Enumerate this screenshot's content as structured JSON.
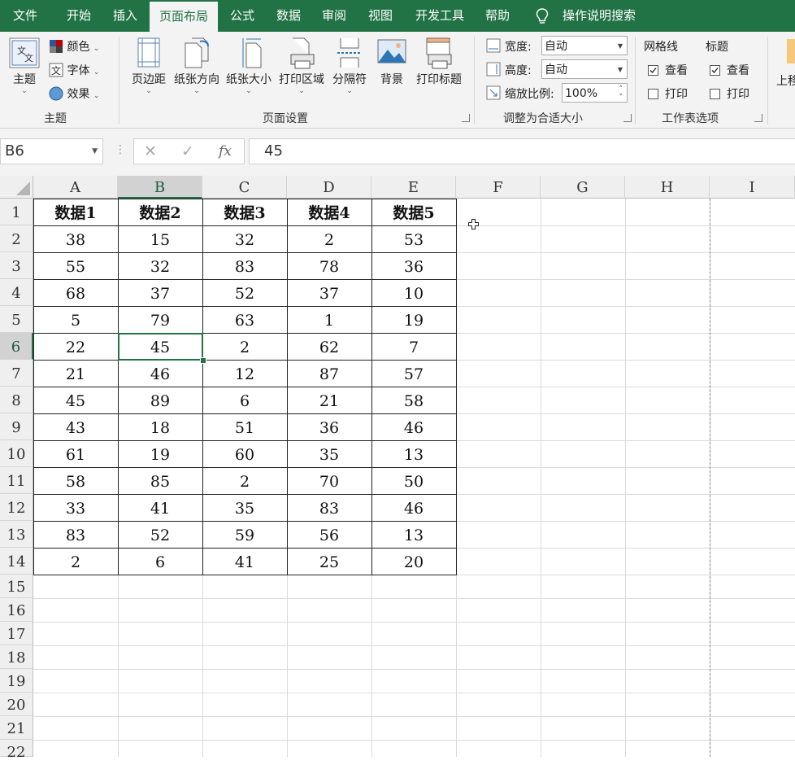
{
  "tabs": [
    "文件",
    "开始",
    "插入",
    "页面布局",
    "公式",
    "数据",
    "审阅",
    "视图",
    "开发工具",
    "帮助"
  ],
  "active_tab": "页面布局",
  "tell_me": "操作说明搜索",
  "ribbon": {
    "theme_group": {
      "themes_label": "主题",
      "colors_label": "颜色",
      "fonts_label": "字体",
      "effects_label": "效果",
      "group_label": "主题"
    },
    "page_setup": {
      "margins": "页边距",
      "orientation": "纸张方向",
      "size": "纸张大小",
      "print_area": "打印区域",
      "breaks": "分隔符",
      "background": "背景",
      "print_titles": "打印标题",
      "group_label": "页面设置"
    },
    "scale_to_fit": {
      "width_label": "宽度:",
      "width_value": "自动",
      "height_label": "高度:",
      "height_value": "自动",
      "scale_label": "缩放比例:",
      "scale_value": "100%",
      "group_label": "调整为合适大小"
    },
    "sheet_options": {
      "gridlines_label": "网格线",
      "headings_label": "标题",
      "view_label": "查看",
      "print_label": "打印",
      "gridlines_view": true,
      "gridlines_print": false,
      "headings_view": true,
      "headings_print": false,
      "group_label": "工作表选项"
    },
    "arrange_partial": "上移"
  },
  "formula_bar": {
    "name_box": "B6",
    "cancel": "✕",
    "enter": "✓",
    "fx": "fx",
    "formula": "45"
  },
  "columns": [
    "A",
    "B",
    "C",
    "D",
    "E",
    "F",
    "G",
    "H",
    "I"
  ],
  "rows": [
    "1",
    "2",
    "3",
    "4",
    "5",
    "6",
    "7",
    "8",
    "9",
    "10",
    "11",
    "12",
    "13",
    "14",
    "15",
    "16",
    "17",
    "18",
    "19",
    "20",
    "21",
    "22"
  ],
  "selected_cell": "B6",
  "table": {
    "headers": [
      "数据1",
      "数据2",
      "数据3",
      "数据4",
      "数据5"
    ],
    "rows": [
      [
        "38",
        "15",
        "32",
        "2",
        "53"
      ],
      [
        "55",
        "32",
        "83",
        "78",
        "36"
      ],
      [
        "68",
        "37",
        "52",
        "37",
        "10"
      ],
      [
        "5",
        "79",
        "63",
        "1",
        "19"
      ],
      [
        "22",
        "45",
        "2",
        "62",
        "7"
      ],
      [
        "21",
        "46",
        "12",
        "87",
        "57"
      ],
      [
        "45",
        "89",
        "6",
        "21",
        "58"
      ],
      [
        "43",
        "18",
        "51",
        "36",
        "46"
      ],
      [
        "61",
        "19",
        "60",
        "35",
        "13"
      ],
      [
        "58",
        "85",
        "2",
        "70",
        "50"
      ],
      [
        "33",
        "41",
        "35",
        "83",
        "46"
      ],
      [
        "83",
        "52",
        "59",
        "56",
        "13"
      ],
      [
        "2",
        "6",
        "41",
        "25",
        "20"
      ]
    ]
  },
  "colors": {
    "brand": "#217346",
    "ribbon_bg": "#f3f3f3",
    "header_bg": "#efefef",
    "selected_header_bg": "#d2d2d2"
  }
}
